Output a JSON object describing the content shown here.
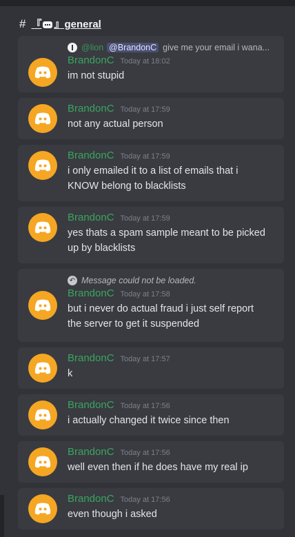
{
  "channel": {
    "prefix": "#",
    "name_left": "『",
    "name_right": "』general"
  },
  "messages": [
    {
      "reply": {
        "author": "@lion",
        "mention": "@BrandonC",
        "text": "give me your email i wana..."
      },
      "author": "BrandonC",
      "time": "Today at 18:02",
      "lines": [
        "im not stupid"
      ]
    },
    {
      "author": "BrandonC",
      "time": "Today at 17:59",
      "lines": [
        "not any actual person"
      ]
    },
    {
      "author": "BrandonC",
      "time": "Today at 17:59",
      "lines": [
        "i only emailed it to a list of emails that i",
        "KNOW belong to blacklists"
      ]
    },
    {
      "author": "BrandonC",
      "time": "Today at 17:59",
      "lines": [
        "yes thats a spam sample meant to be picked",
        "up by blacklists"
      ]
    },
    {
      "reply_missing": "Message could not be loaded.",
      "author": "BrandonC",
      "time": "Today at 17:58",
      "lines": [
        "but i never do actual fraud i just self report",
        "the server to get it suspended"
      ]
    },
    {
      "author": "BrandonC",
      "time": "Today at 17:57",
      "lines": [
        "k"
      ]
    },
    {
      "author": "BrandonC",
      "time": "Today at 17:56",
      "lines": [
        "i actually changed it twice since then"
      ]
    },
    {
      "author": "BrandonC",
      "time": "Today at 17:56",
      "lines": [
        "well even then if he does have my real ip"
      ]
    },
    {
      "author": "BrandonC",
      "time": "Today at 17:56",
      "lines": [
        "even though i asked"
      ]
    }
  ],
  "colors": {
    "avatar": "#f5a623",
    "author": "#3ba55d",
    "background": "#313338",
    "card": "#393b41"
  },
  "icons": {
    "avatar": "discord-logo-icon",
    "reply": "info-icon",
    "missing": "reply-arrow-icon"
  }
}
